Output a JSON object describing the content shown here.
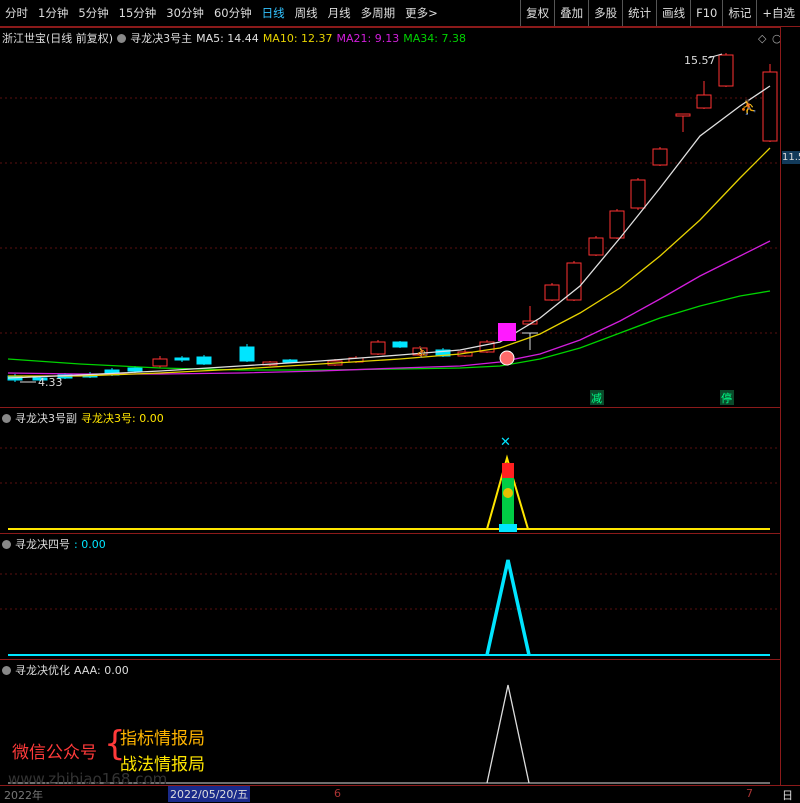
{
  "toolbar": {
    "left": [
      {
        "label": "分时",
        "name": "tab-intraday"
      },
      {
        "label": "1分钟",
        "name": "tab-1min"
      },
      {
        "label": "5分钟",
        "name": "tab-5min"
      },
      {
        "label": "15分钟",
        "name": "tab-15min"
      },
      {
        "label": "30分钟",
        "name": "tab-30min"
      },
      {
        "label": "60分钟",
        "name": "tab-60min"
      },
      {
        "label": "日线",
        "name": "tab-daily",
        "active": true
      },
      {
        "label": "周线",
        "name": "tab-weekly"
      },
      {
        "label": "月线",
        "name": "tab-monthly"
      },
      {
        "label": "多周期",
        "name": "tab-multi-period"
      },
      {
        "label": "更多>",
        "name": "tab-more"
      }
    ],
    "right": [
      {
        "label": "复权",
        "name": "adjust-button"
      },
      {
        "label": "叠加",
        "name": "overlay-button"
      },
      {
        "label": "多股",
        "name": "multi-stock-button"
      },
      {
        "label": "统计",
        "name": "stats-button"
      },
      {
        "label": "画线",
        "name": "draw-line-button"
      },
      {
        "label": "F10",
        "name": "f10-button"
      },
      {
        "label": "标记",
        "name": "mark-button"
      },
      {
        "label": "+自选",
        "name": "add-watchlist-button"
      }
    ]
  },
  "main": {
    "stock": "浙江世宝(日线 前复权)",
    "indicator": "寻龙决3号主",
    "ma5": "MA5: 14.44",
    "ma10": "MA10: 12.37",
    "ma21": "MA21: 9.13",
    "ma34": "MA34: 7.38",
    "high_label": "15.57",
    "low_label": "4.33",
    "price_tag": "11.5",
    "signal_jian": "减",
    "signal_ting": "停"
  },
  "sub1": {
    "title": "寻龙决3号副",
    "value": "寻龙决3号: 0.00"
  },
  "sub2": {
    "title": "寻龙决四号",
    "value": ": 0.00"
  },
  "sub3": {
    "title": "寻龙决优化",
    "value": "AAA: 0.00"
  },
  "watermark": {
    "wechat": "微信公众号",
    "line1": "指标情报局",
    "line2": "战法情报局",
    "site": "www.zhibiao168.com"
  },
  "axis": {
    "year": "2022年",
    "date": "2022/05/20/五",
    "m6": "6",
    "m7": "7",
    "day": "日"
  },
  "colors": {
    "up": "#ff3232",
    "down": "#00e5ff",
    "ma5": "#e0e0e0",
    "ma10": "#e6d200",
    "ma21": "#d21edc",
    "ma34": "#00d200",
    "yellow": "#ffe600",
    "cyan": "#00e5ff"
  }
}
